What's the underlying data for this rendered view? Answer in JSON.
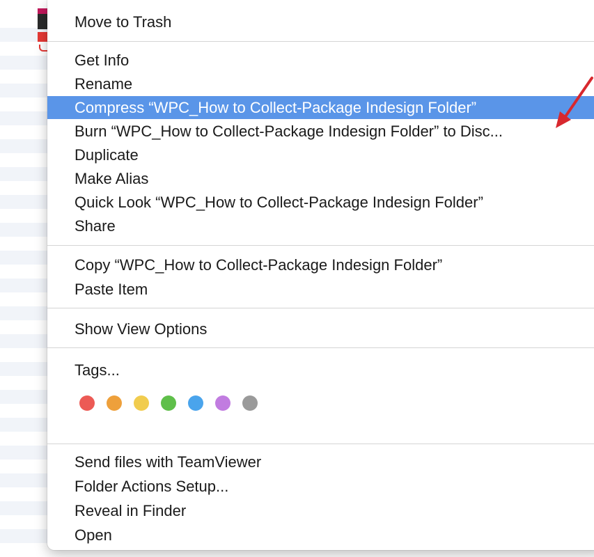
{
  "menu": {
    "groups": [
      {
        "items": [
          {
            "label": "Move to Trash"
          }
        ]
      },
      {
        "items": [
          {
            "label": "Get Info"
          },
          {
            "label": "Rename"
          },
          {
            "label": "Compress “WPC_How to Collect-Package Indesign Folder”",
            "highlighted": true
          },
          {
            "label": "Burn “WPC_How to Collect-Package Indesign Folder” to Disc..."
          },
          {
            "label": "Duplicate"
          },
          {
            "label": "Make Alias"
          },
          {
            "label": "Quick Look “WPC_How to Collect-Package Indesign Folder”"
          },
          {
            "label": "Share",
            "has_submenu": true
          }
        ]
      },
      {
        "items": [
          {
            "label": "Copy “WPC_How to Collect-Package Indesign Folder”"
          },
          {
            "label": "Paste Item"
          }
        ]
      },
      {
        "items": [
          {
            "label": "Show View Options"
          }
        ]
      },
      {
        "items": [
          {
            "label": "Tags..."
          }
        ]
      },
      {
        "items": [
          {
            "label": "Send files with TeamViewer"
          },
          {
            "label": "Folder Actions Setup..."
          },
          {
            "label": "Reveal in Finder"
          },
          {
            "label": "Open"
          }
        ]
      }
    ],
    "submenu_arrow": "▶",
    "tag_colors": [
      {
        "name": "red",
        "color": "#ec5a55"
      },
      {
        "name": "orange",
        "color": "#eea03b"
      },
      {
        "name": "yellow",
        "color": "#f1cc4e"
      },
      {
        "name": "green",
        "color": "#5fbf4a"
      },
      {
        "name": "blue",
        "color": "#4aa4ec"
      },
      {
        "name": "purple",
        "color": "#c17ce0"
      },
      {
        "name": "gray",
        "color": "#9a9a9a"
      }
    ],
    "highlight_color": "#5a95e8"
  },
  "annotation": {
    "icon": "red-arrow-icon",
    "color": "#d8282e"
  }
}
